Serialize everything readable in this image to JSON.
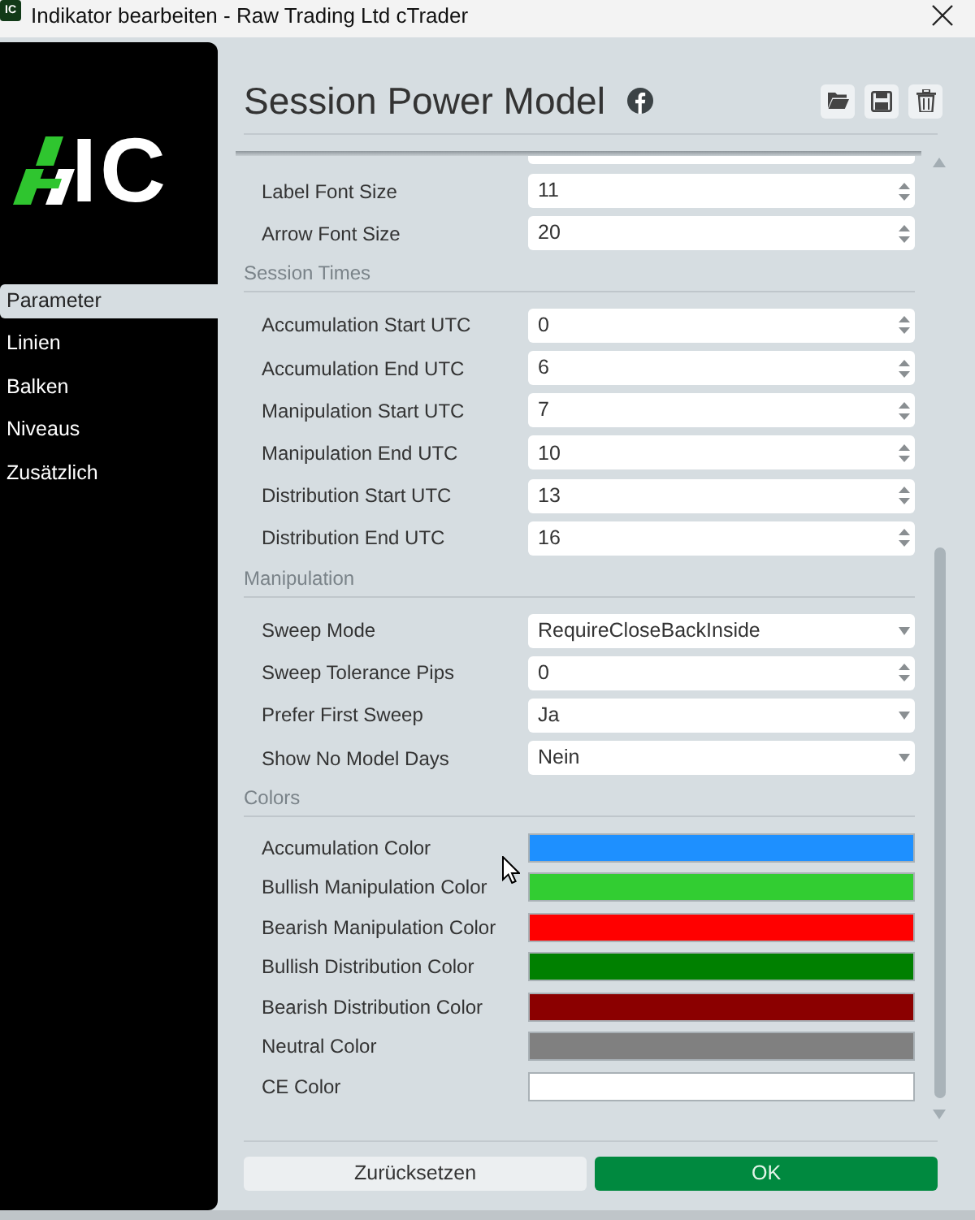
{
  "window": {
    "icon_text": "IC",
    "title": "Indikator bearbeiten - Raw Trading Ltd cTrader"
  },
  "sidebar": {
    "logo_text": "IC",
    "items": [
      {
        "label": "Parameter",
        "selected": true
      },
      {
        "label": "Linien",
        "selected": false
      },
      {
        "label": "Balken",
        "selected": false
      },
      {
        "label": "Niveaus",
        "selected": false
      },
      {
        "label": "Zusätzlich",
        "selected": false
      }
    ]
  },
  "header": {
    "title": "Session Power Model"
  },
  "groups": [
    {
      "rows": [
        {
          "label": "Label Font Size",
          "kind": "spin",
          "value": "11"
        },
        {
          "label": "Arrow Font Size",
          "kind": "spin",
          "value": "20"
        }
      ]
    },
    {
      "heading": "Session Times",
      "rows": [
        {
          "label": "Accumulation Start UTC",
          "kind": "spin",
          "value": "0"
        },
        {
          "label": "Accumulation End UTC",
          "kind": "spin",
          "value": "6"
        },
        {
          "label": "Manipulation Start UTC",
          "kind": "spin",
          "value": "7"
        },
        {
          "label": "Manipulation End UTC",
          "kind": "spin",
          "value": "10"
        },
        {
          "label": "Distribution Start UTC",
          "kind": "spin",
          "value": "13"
        },
        {
          "label": "Distribution End UTC",
          "kind": "spin",
          "value": "16"
        }
      ]
    },
    {
      "heading": "Manipulation",
      "rows": [
        {
          "label": "Sweep Mode",
          "kind": "select",
          "value": "RequireCloseBackInside"
        },
        {
          "label": "Sweep Tolerance Pips",
          "kind": "spin",
          "value": "0"
        },
        {
          "label": "Prefer First Sweep",
          "kind": "select",
          "value": "Ja"
        },
        {
          "label": "Show No Model Days",
          "kind": "select",
          "value": "Nein"
        }
      ]
    },
    {
      "heading": "Colors",
      "rows": [
        {
          "label": "Accumulation Color",
          "kind": "color",
          "color": "#1e90ff"
        },
        {
          "label": "Bullish Manipulation Color",
          "kind": "color",
          "color": "#32cd32"
        },
        {
          "label": "Bearish Manipulation Color",
          "kind": "color",
          "color": "#ff0000"
        },
        {
          "label": "Bullish Distribution Color",
          "kind": "color",
          "color": "#008000"
        },
        {
          "label": "Bearish Distribution Color",
          "kind": "color",
          "color": "#8b0000"
        },
        {
          "label": "Neutral Color",
          "kind": "color",
          "color": "#808080"
        },
        {
          "label": "CE Color",
          "kind": "color",
          "color": "#ffffff"
        }
      ]
    }
  ],
  "buttons": [
    {
      "label": "Zurücksetzen",
      "kind": "secondary"
    },
    {
      "label": "OK",
      "kind": "primary"
    }
  ]
}
